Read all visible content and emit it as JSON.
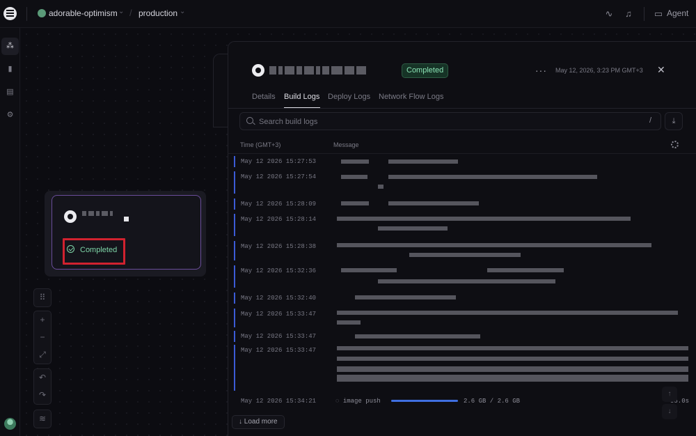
{
  "topbar": {
    "project_name": "adorable-optimism",
    "environment": "production",
    "agent_label": "Agent",
    "icons": [
      "activity-icon",
      "bell-icon",
      "chat-icon"
    ]
  },
  "sidebar": {
    "items": [
      {
        "icon": "architecture-icon",
        "active": true
      },
      {
        "icon": "metrics-icon",
        "active": false
      },
      {
        "icon": "logs-icon",
        "active": false
      },
      {
        "icon": "settings-icon",
        "active": false
      }
    ]
  },
  "service_card": {
    "status": "Completed"
  },
  "deployment_panel": {
    "status": "Completed",
    "timestamp": "May 12, 2026, 3:23 PM GMT+3",
    "tabs": [
      {
        "label": "Details"
      },
      {
        "label": "Build Logs"
      },
      {
        "label": "Deploy Logs"
      },
      {
        "label": "Network Flow Logs"
      }
    ],
    "active_tab": "Build Logs",
    "search": {
      "placeholder": "Search build logs",
      "shortcut": "/"
    },
    "columns": {
      "time": "Time (GMT+3)",
      "message": "Message"
    },
    "logs": [
      {
        "time": "May 12 2026 15:27:53"
      },
      {
        "time": "May 12 2026 15:27:54"
      },
      {
        "time": "May 12 2026 15:28:09"
      },
      {
        "time": "May 12 2026 15:28:14"
      },
      {
        "time": "May 12 2026 15:28:38"
      },
      {
        "time": "May 12 2026 15:32:36"
      },
      {
        "time": "May 12 2026 15:32:40"
      },
      {
        "time": "May 12 2026 15:33:47"
      },
      {
        "time": "May 12 2026 15:33:47"
      },
      {
        "time": "May 12 2026 15:33:47"
      },
      {
        "time": "May 12 2026 15:34:21"
      }
    ],
    "last_log": {
      "message": "image push",
      "size": "2.6 GB / 2.6 GB",
      "duration": "55.0s",
      "progress": 1.0
    },
    "load_more_label": "Load more"
  },
  "colors": {
    "accent_green": "#8be3b5",
    "log_bar": "#3b5bd6",
    "card_border": "#6a4d9a",
    "highlight_red": "#d1222f"
  }
}
